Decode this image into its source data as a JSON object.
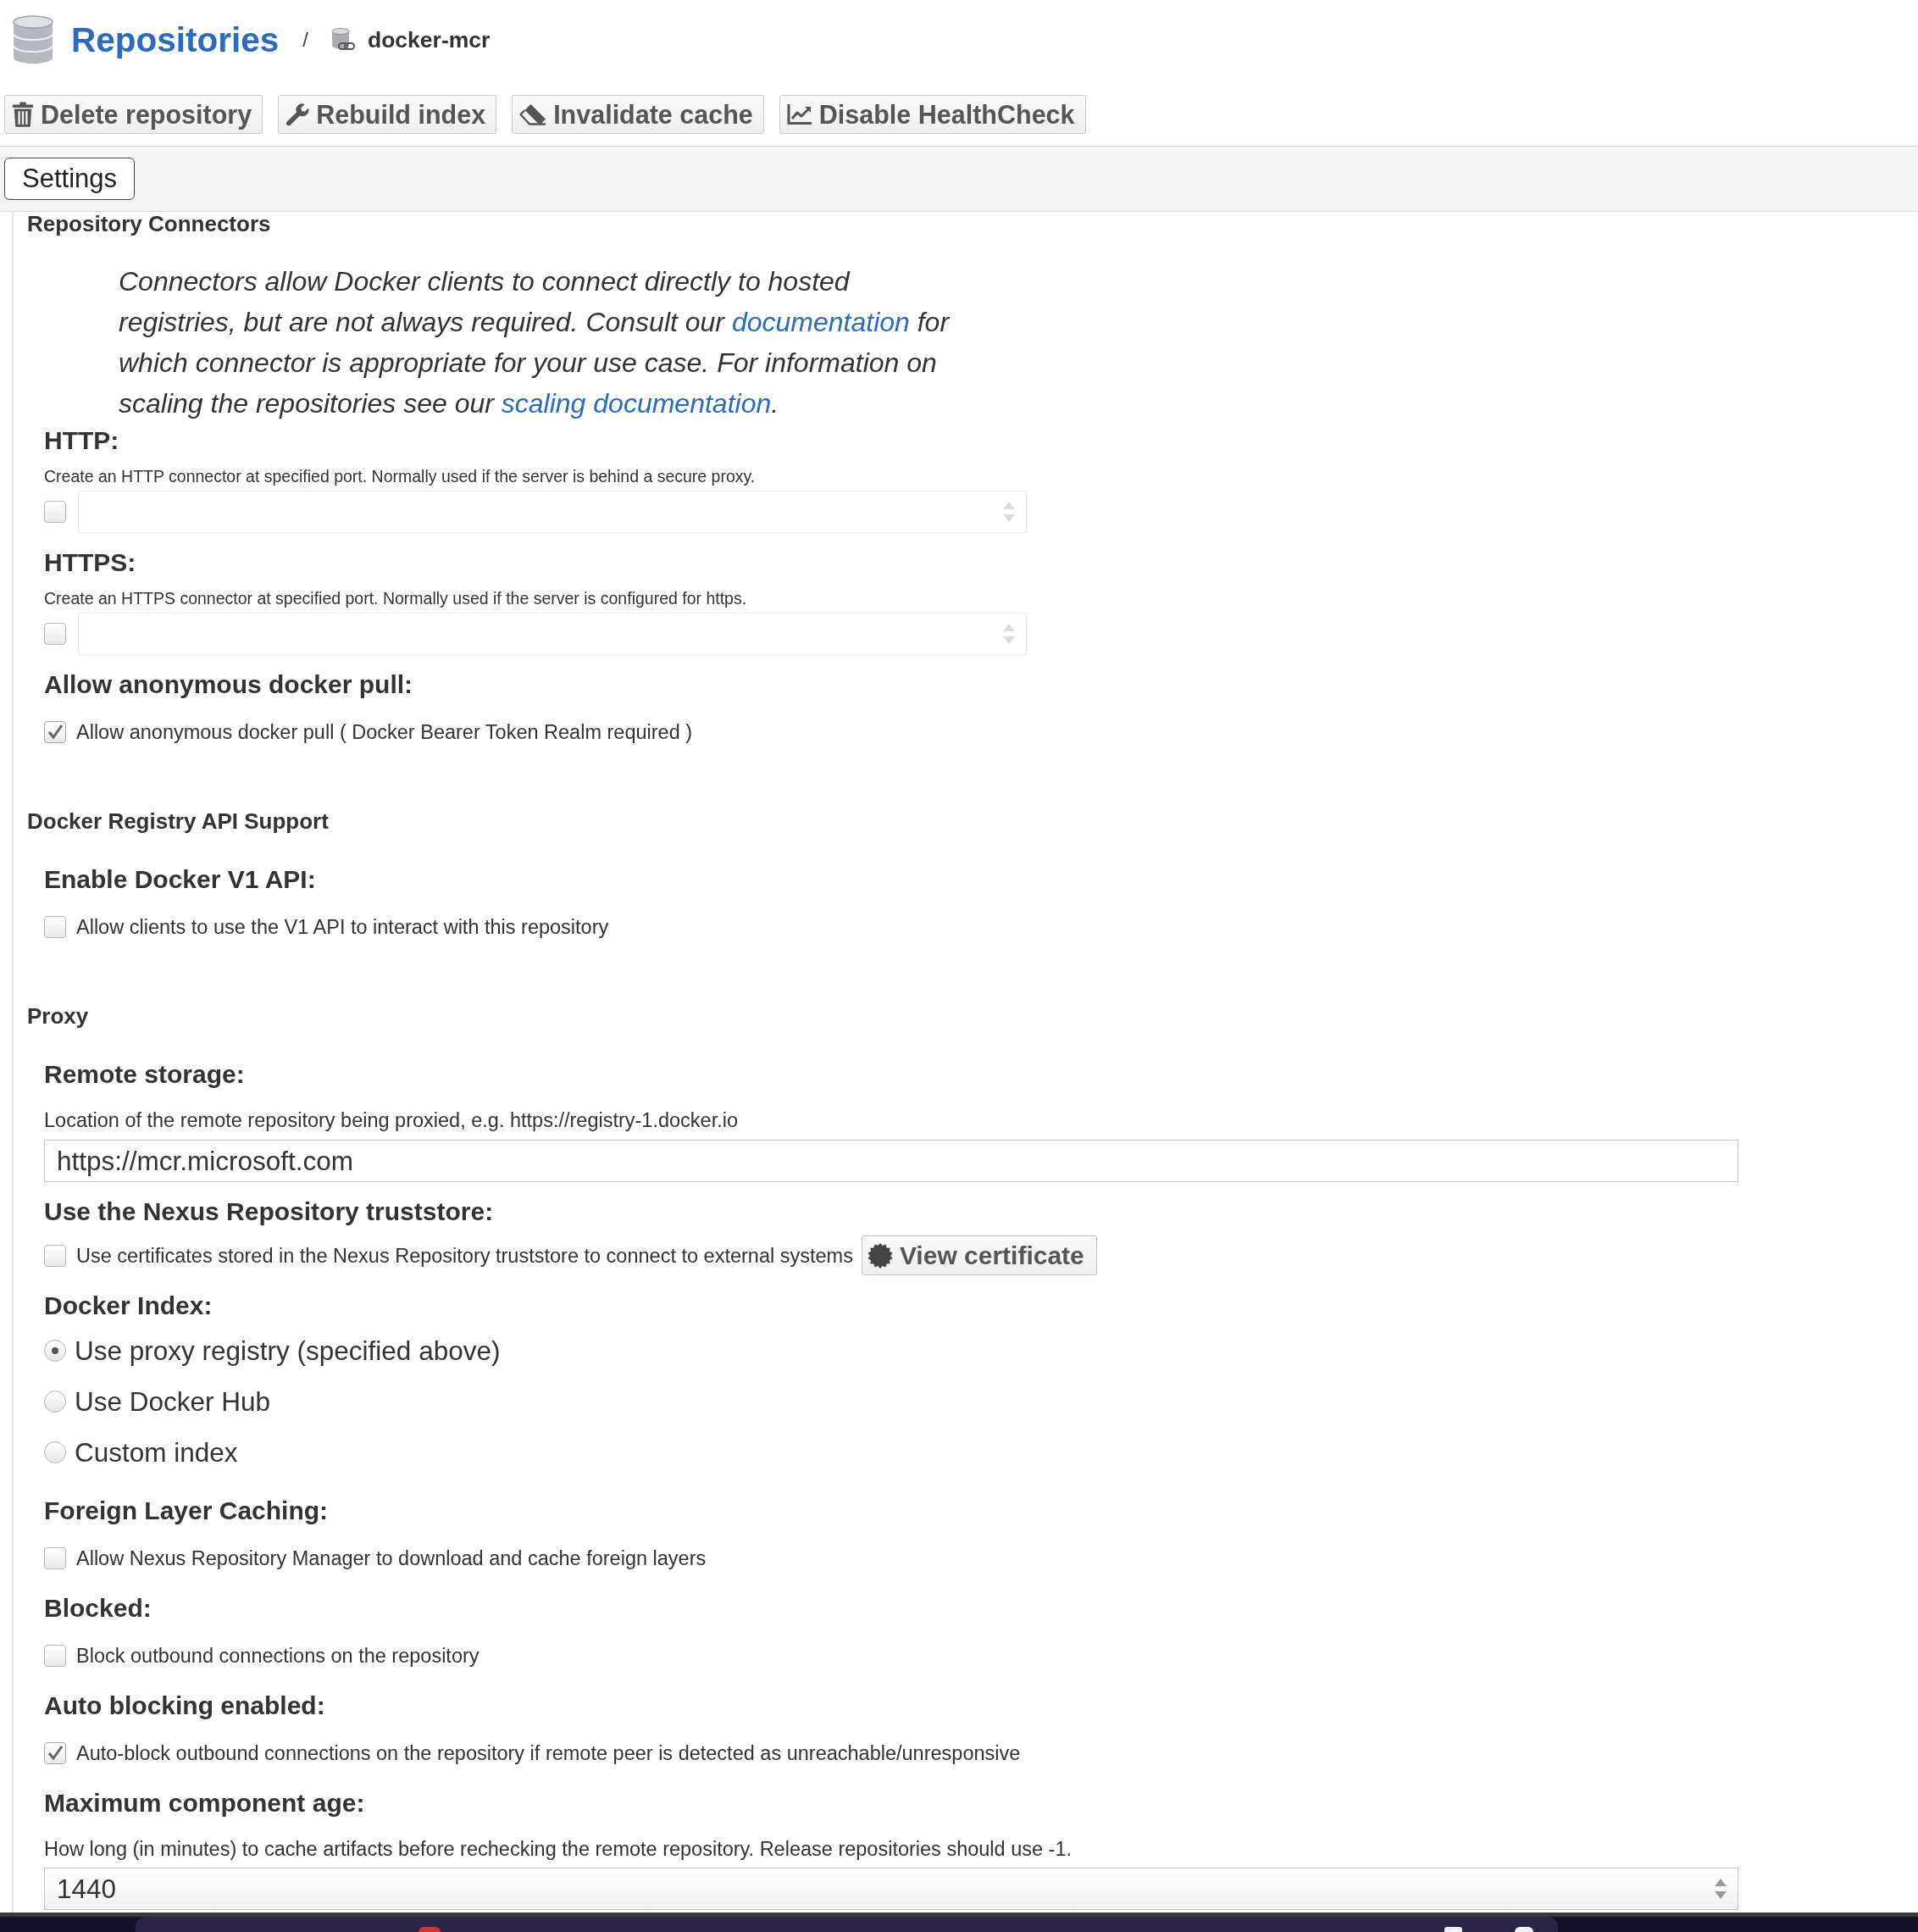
{
  "breadcrumb": {
    "title": "Repositories",
    "separator": "/",
    "current": "docker-mcr"
  },
  "toolbar": [
    {
      "kind": "delete",
      "label": "Delete repository"
    },
    {
      "kind": "rebuild",
      "label": "Rebuild index"
    },
    {
      "kind": "invalidate",
      "label": "Invalidate cache"
    },
    {
      "kind": "healthcheck",
      "label": "Disable HealthCheck"
    }
  ],
  "tabs": [
    {
      "label": "Settings",
      "selected": true
    }
  ],
  "sections": [
    {
      "title": "Repository Connectors",
      "intro": [
        {
          "kind": "text",
          "text": "Connectors allow Docker clients to connect directly to hosted registries, but are not always required. Consult our "
        },
        {
          "kind": "link",
          "text": "documentation"
        },
        {
          "kind": "text",
          "text": " for which connector is appropriate for your use case. For information on scaling the repositories see our "
        },
        {
          "kind": "link",
          "text": "scaling documentation"
        },
        {
          "kind": "text",
          "text": "."
        }
      ],
      "fields": [
        {
          "kind": "port",
          "heading": "HTTP:",
          "help": "Create an HTTP connector at specified port. Normally used if the server is behind a secure proxy.",
          "checked": false,
          "disabled": true
        },
        {
          "kind": "port",
          "heading": "HTTPS:",
          "help": "Create an HTTPS connector at specified port. Normally used if the server is configured for https.",
          "checked": false,
          "disabled": true
        },
        {
          "kind": "checkbox",
          "heading": "Allow anonymous docker pull:",
          "option": "Allow anonymous docker pull ( Docker Bearer Token Realm required )",
          "checked": true
        }
      ]
    },
    {
      "title": "Docker Registry API Support",
      "fields": [
        {
          "kind": "checkbox",
          "heading": "Enable Docker V1 API:",
          "option": "Allow clients to use the V1 API to interact with this repository",
          "checked": false
        }
      ]
    },
    {
      "title": "Proxy",
      "fields": [
        {
          "kind": "text",
          "heading": "Remote storage:",
          "help": "Location of the remote repository being proxied, e.g. https://registry-1.docker.io",
          "value": "https://mcr.microsoft.com"
        },
        {
          "kind": "checkbox",
          "heading": "Use the Nexus Repository truststore:",
          "option": "Use certificates stored in the Nexus Repository truststore to connect to external systems",
          "checked": false,
          "button": "View certificate"
        },
        {
          "kind": "radio",
          "heading": "Docker Index:",
          "options": [
            {
              "label": "Use proxy registry (specified above)",
              "selected": true
            },
            {
              "label": "Use Docker Hub",
              "selected": false
            },
            {
              "label": "Custom index",
              "selected": false
            }
          ]
        },
        {
          "kind": "checkbox",
          "heading": "Foreign Layer Caching:",
          "option": "Allow Nexus Repository Manager to download and cache foreign layers",
          "checked": false
        },
        {
          "kind": "checkbox",
          "heading": "Blocked:",
          "option": "Block outbound connections on the repository",
          "checked": false
        },
        {
          "kind": "checkbox",
          "heading": "Auto blocking enabled:",
          "option": "Auto-block outbound connections on the repository if remote peer is detected as unreachable/unresponsive",
          "checked": true
        },
        {
          "kind": "number",
          "heading": "Maximum component age:",
          "help": "How long (in minutes) to cache artifacts before rechecking the remote repository. Release repositories should use -1.",
          "value": "1440"
        }
      ]
    }
  ]
}
